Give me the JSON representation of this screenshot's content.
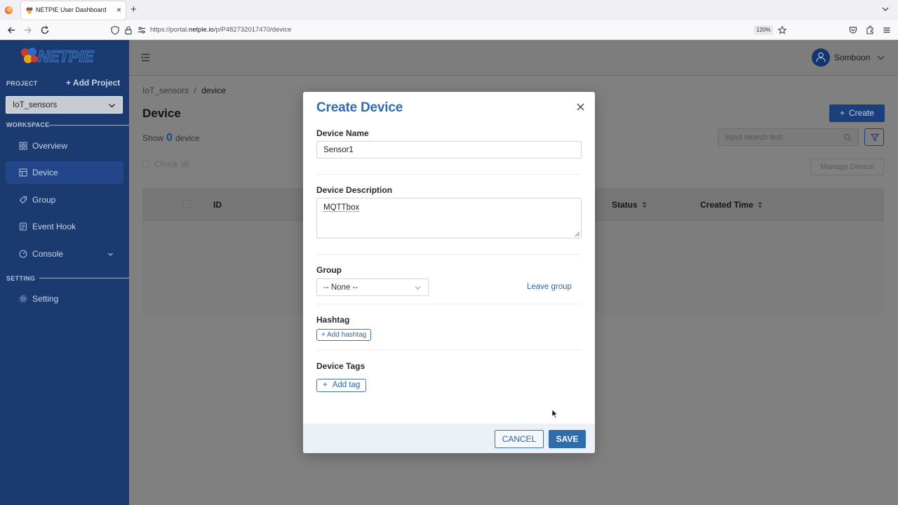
{
  "browser": {
    "tab_title": "NETPIE User Dashboard",
    "url_prefix": "https://portal.",
    "url_domain": "netpie.io",
    "url_path": "/p/P482732017470/device",
    "zoom": "120%"
  },
  "sidebar": {
    "project_label": "PROJECT",
    "add_project": "+ Add Project",
    "project_selected": "IoT_sensors",
    "workspace_label": "WORKSPACE",
    "items": [
      {
        "label": "Overview",
        "icon": "grid-icon"
      },
      {
        "label": "Device",
        "icon": "device-icon"
      },
      {
        "label": "Group",
        "icon": "tag-icon"
      },
      {
        "label": "Event Hook",
        "icon": "event-hook-icon"
      },
      {
        "label": "Console",
        "icon": "console-icon"
      }
    ],
    "setting_label": "SETTING",
    "setting_item": "Setting"
  },
  "header": {
    "user_name": "Somboon"
  },
  "page": {
    "breadcrumb_root": "IoT_sensors",
    "breadcrumb_sep": "/",
    "breadcrumb_current": "device",
    "title": "Device",
    "show_prefix": "Show",
    "device_count": "0",
    "show_suffix": "device",
    "check_all": "Check all",
    "create_label": "Create",
    "search_placeholder": "input search text",
    "manage_device": "Manage Device",
    "columns": [
      "ID",
      "Status",
      "Created Time"
    ]
  },
  "modal": {
    "title": "Create Device",
    "device_name_label": "Device Name",
    "device_name_value": "Sensor1",
    "description_label": "Device Description",
    "description_value": "MQTTbox",
    "group_label": "Group",
    "group_value": "-- None --",
    "leave_group": "Leave group",
    "hashtag_label": "Hashtag",
    "add_hashtag": "+ Add hashtag",
    "device_tags_label": "Device Tags",
    "add_tag": "Add tag",
    "cancel": "CANCEL",
    "save": "SAVE"
  },
  "colors": {
    "sidebar_bg": "#1a3a70",
    "primary": "#2f6cab",
    "title_blue": "#2f6cab"
  }
}
